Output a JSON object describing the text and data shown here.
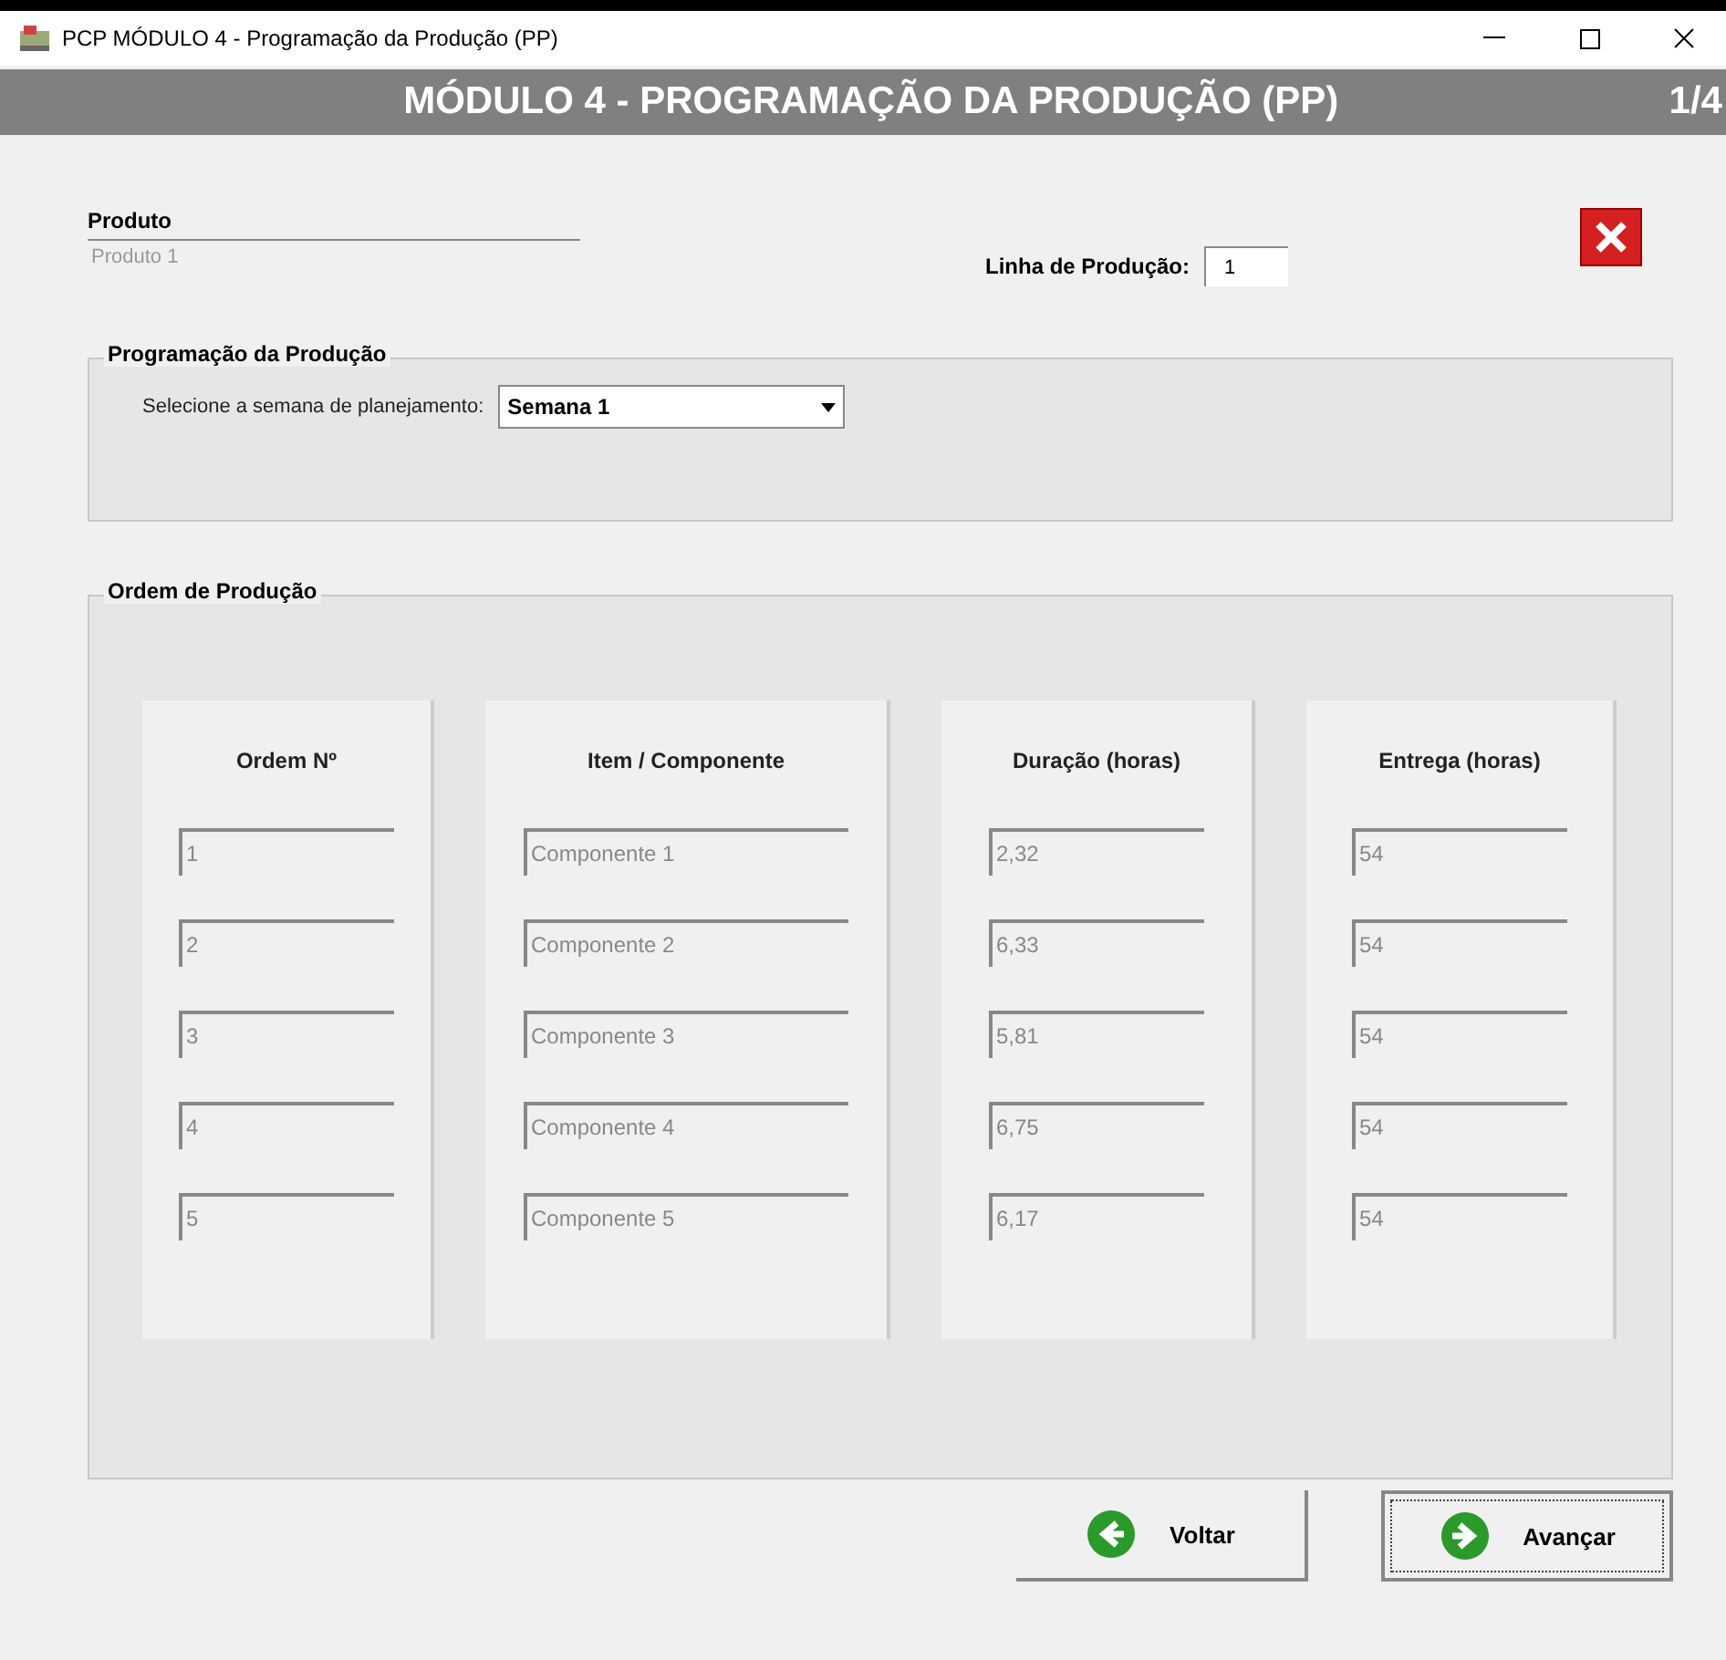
{
  "window": {
    "title": "PCP MÓDULO 4 - Programação da Produção (PP)"
  },
  "header": {
    "title": "MÓDULO 4 - PROGRAMAÇÃO DA PRODUÇÃO (PP)",
    "page": "1/4"
  },
  "produto": {
    "label": "Produto",
    "value": "Produto 1"
  },
  "linha": {
    "label": "Linha de Produção:",
    "value": "1"
  },
  "programacao": {
    "title": "Programação da Produção",
    "label": "Selecione a semana de planejamento:",
    "value": "Semana 1"
  },
  "ordem": {
    "title": "Ordem de Produção",
    "columns": [
      {
        "heading": "Ordem Nº",
        "values": [
          "1",
          "2",
          "3",
          "4",
          "5"
        ]
      },
      {
        "heading": "Item / Componente",
        "values": [
          "Componente 1",
          "Componente 2",
          "Componente 3",
          "Componente 4",
          "Componente 5"
        ]
      },
      {
        "heading": "Duração (horas)",
        "values": [
          "2,32",
          "6,33",
          "5,81",
          "6,75",
          "6,17"
        ]
      },
      {
        "heading": "Entrega (horas)",
        "values": [
          "54",
          "54",
          "54",
          "54",
          "54"
        ]
      }
    ]
  },
  "buttons": [
    {
      "label": "Voltar",
      "kind": "back",
      "focused": false
    },
    {
      "label": "Avançar",
      "kind": "next",
      "focused": true
    }
  ]
}
